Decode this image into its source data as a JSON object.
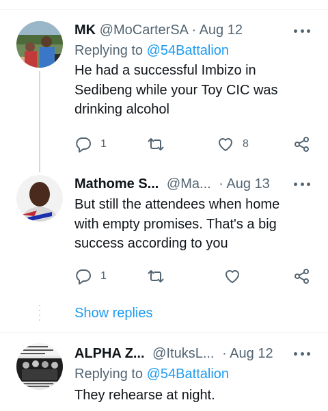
{
  "tweets": [
    {
      "display_name": "MK",
      "handle": "@MoCarterSA",
      "date": "· Aug 12",
      "replying_prefix": "Replying to",
      "replying_to": "@54Battalion",
      "text": "He had a successful Imbizo in Sedibeng while your Toy CIC was drinking alcohol",
      "replies": "1",
      "retweets": "",
      "likes": "8"
    },
    {
      "display_name": "Mathome S...",
      "handle": "@Ma...",
      "date": "· Aug 13",
      "text": "But still the attendees when home with empty promises. That's a big success according to you",
      "replies": "1",
      "retweets": "",
      "likes": ""
    },
    {
      "display_name": "ALPHA Z...",
      "handle": "@ItuksL...",
      "date": "· Aug 12",
      "replying_prefix": "Replying to",
      "replying_to": "@54Battalion",
      "text": "They rehearse at night."
    }
  ],
  "show_replies_label": "Show replies",
  "icons": {
    "more": "more-dots-icon",
    "reply": "reply-bubble-icon",
    "retweet": "retweet-icon",
    "like": "heart-icon",
    "share": "share-icon"
  },
  "colors": {
    "link": "#1d9bf0",
    "muted": "#536471",
    "text": "#0f1419",
    "divider": "#eff3f4"
  }
}
